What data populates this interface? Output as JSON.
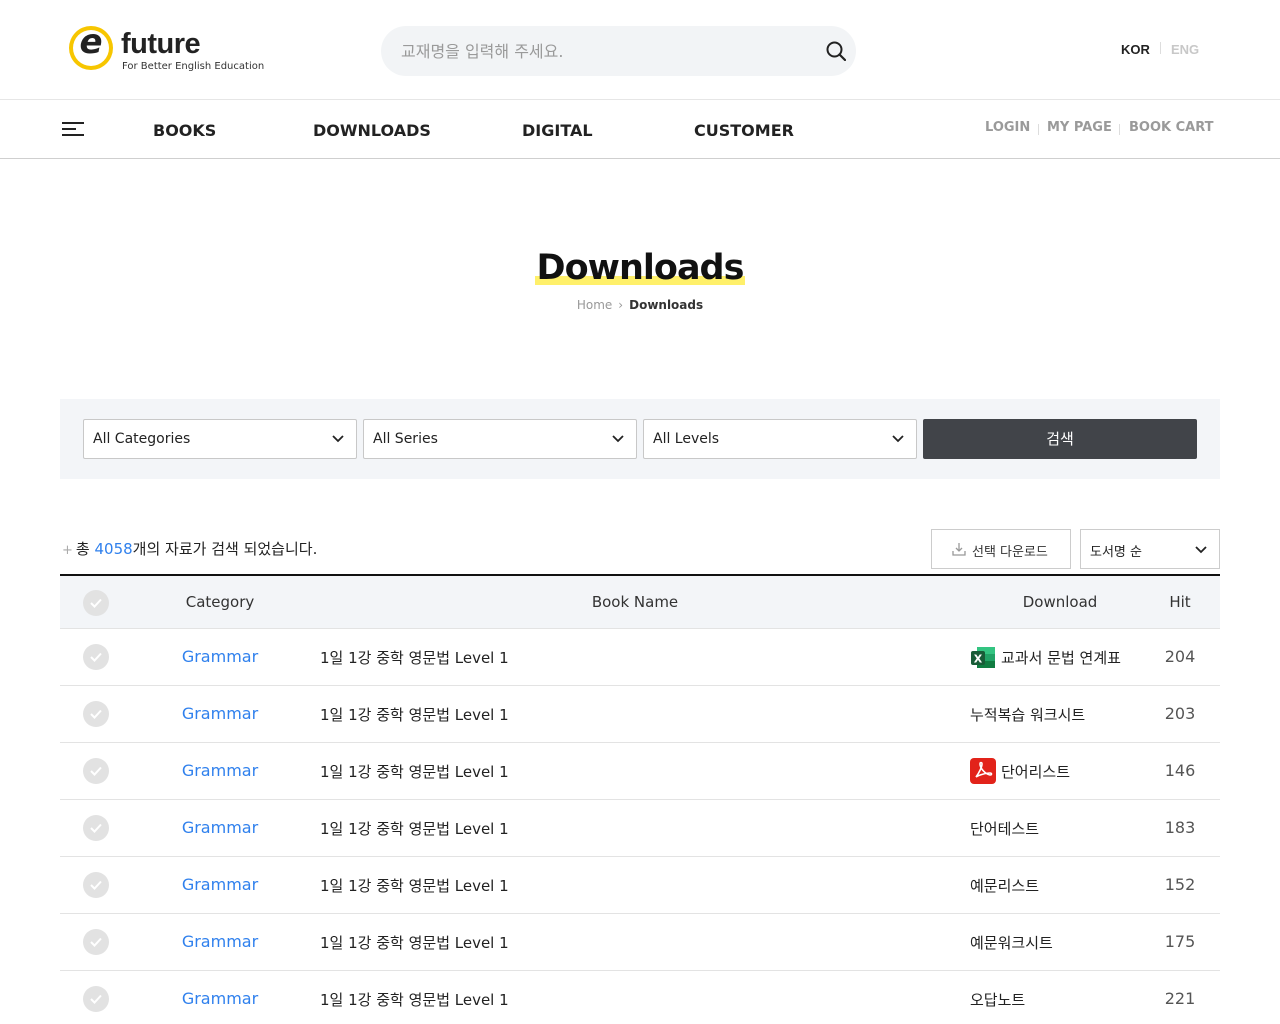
{
  "header": {
    "logo_text": "future",
    "logo_tagline": "For Better English Education",
    "search_placeholder": "교재명을 입력해 주세요.",
    "lang": {
      "kor": "KOR",
      "eng": "ENG"
    }
  },
  "nav": {
    "items": [
      "BOOKS",
      "DOWNLOADS",
      "DIGITAL",
      "CUSTOMER"
    ],
    "util": [
      "LOGIN",
      "MY PAGE",
      "BOOK CART"
    ]
  },
  "page": {
    "title": "Downloads",
    "breadcrumb": {
      "home": "Home",
      "current": "Downloads"
    }
  },
  "filters": {
    "category": "All Categories",
    "series": "All Series",
    "level": "All Levels",
    "search_button": "검색"
  },
  "results": {
    "prefix": "총 ",
    "count": "4058",
    "suffix": "개의 자료가 검색 되었습니다.",
    "download_selected": "선택 다운로드",
    "sort": "도서명 순"
  },
  "table": {
    "headers": {
      "category": "Category",
      "book": "Book Name",
      "download": "Download",
      "hit": "Hit"
    },
    "rows": [
      {
        "category": "Grammar",
        "book": "1일 1강 중학 영문법 Level 1",
        "download": "교과서 문법 연계표",
        "icon": "excel-icon",
        "hit": "204"
      },
      {
        "category": "Grammar",
        "book": "1일 1강 중학 영문법 Level 1",
        "download": "누적복습 워크시트",
        "icon": "",
        "hit": "203"
      },
      {
        "category": "Grammar",
        "book": "1일 1강 중학 영문법 Level 1",
        "download": "단어리스트",
        "icon": "pdf-icon",
        "hit": "146"
      },
      {
        "category": "Grammar",
        "book": "1일 1강 중학 영문법 Level 1",
        "download": "단어테스트",
        "icon": "",
        "hit": "183"
      },
      {
        "category": "Grammar",
        "book": "1일 1강 중학 영문법 Level 1",
        "download": "예문리스트",
        "icon": "",
        "hit": "152"
      },
      {
        "category": "Grammar",
        "book": "1일 1강 중학 영문법 Level 1",
        "download": "예문워크시트",
        "icon": "",
        "hit": "175"
      },
      {
        "category": "Grammar",
        "book": "1일 1강 중학 영문법 Level 1",
        "download": "오답노트",
        "icon": "",
        "hit": "221"
      }
    ]
  },
  "colors": {
    "accent": "#2f80ed",
    "highlight": "#fff06a",
    "button": "#414449",
    "logo": "#f7c600"
  }
}
